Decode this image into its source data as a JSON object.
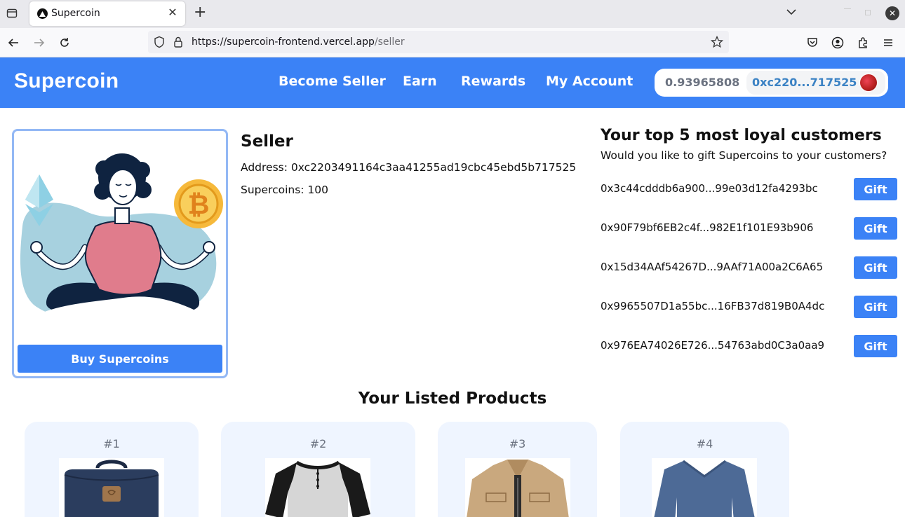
{
  "browser": {
    "tab_title": "Supercoin",
    "url_host": "https://supercoin-frontend.vercel.app",
    "url_path": "/seller"
  },
  "header": {
    "brand": "Supercoin",
    "nav": [
      "Become Seller",
      "Earn",
      "Rewards",
      "My Account"
    ],
    "wallet_balance": "0.93965808",
    "wallet_address": "0xc220...717525"
  },
  "seller": {
    "title": "Seller",
    "address": "Address: 0xc2203491164c3aa41255ad19cbc45ebd5b717525",
    "supercoins": "Supercoins: 100",
    "buy_label": "Buy Supercoins"
  },
  "customers": {
    "title": "Your top 5 most loyal customers",
    "subtitle": "Would you like to gift Supercoins to your customers?",
    "gift_label": "Gift",
    "list": [
      "0x3c44cdddb6a900...99e03d12fa4293bc",
      "0x90F79bf6EB2c4f...982E1f101E93b906",
      "0x15d34AAf54267D...9AAf71A00a2C6A65",
      "0x9965507D1a55bc...16FB37d819B0A4dc",
      "0x976EA74026E726...54763abd0C3a0aa9"
    ]
  },
  "products": {
    "title": "Your Listed Products",
    "items": [
      {
        "num": "#1",
        "image": "navy-backpack"
      },
      {
        "num": "#2",
        "image": "henley-shirt"
      },
      {
        "num": "#3",
        "image": "khaki-jacket"
      },
      {
        "num": "#4",
        "image": "blue-sweater"
      }
    ]
  },
  "colors": {
    "primary": "#3b82f6",
    "card_border": "#93b8f5",
    "product_bg": "#eff5ff"
  }
}
